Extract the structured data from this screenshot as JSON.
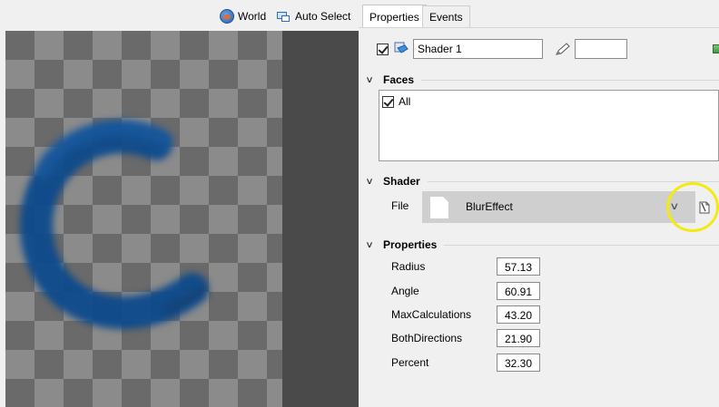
{
  "toolbar": {
    "world_label": "World",
    "auto_select_label": "Auto Select"
  },
  "tabs": [
    {
      "label": "Properties",
      "active": true
    },
    {
      "label": "Events",
      "active": false
    }
  ],
  "material": {
    "enabled": true,
    "name": "Shader 1",
    "secondary_value": ""
  },
  "faces": {
    "title": "Faces",
    "items": [
      {
        "label": "All",
        "checked": true
      }
    ]
  },
  "shader": {
    "title": "Shader",
    "file_label": "File",
    "file_value": "BlurEffect"
  },
  "properties": {
    "title": "Properties",
    "rows": [
      {
        "label": "Radius",
        "value": "57.13"
      },
      {
        "label": "Angle",
        "value": "60.91"
      },
      {
        "label": "MaxCalculations",
        "value": "43.20"
      },
      {
        "label": "BothDirections",
        "value": "21.90"
      },
      {
        "label": "Percent",
        "value": "32.30"
      }
    ]
  },
  "colors": {
    "logo_blue": "#0d4a8c",
    "highlight_ring": "#f3ea12"
  },
  "icons": [
    "globe-icon",
    "auto-select-icon",
    "cube-icon",
    "pen-icon",
    "document-icon",
    "chevron-down-icon",
    "browse-file-icon"
  ]
}
